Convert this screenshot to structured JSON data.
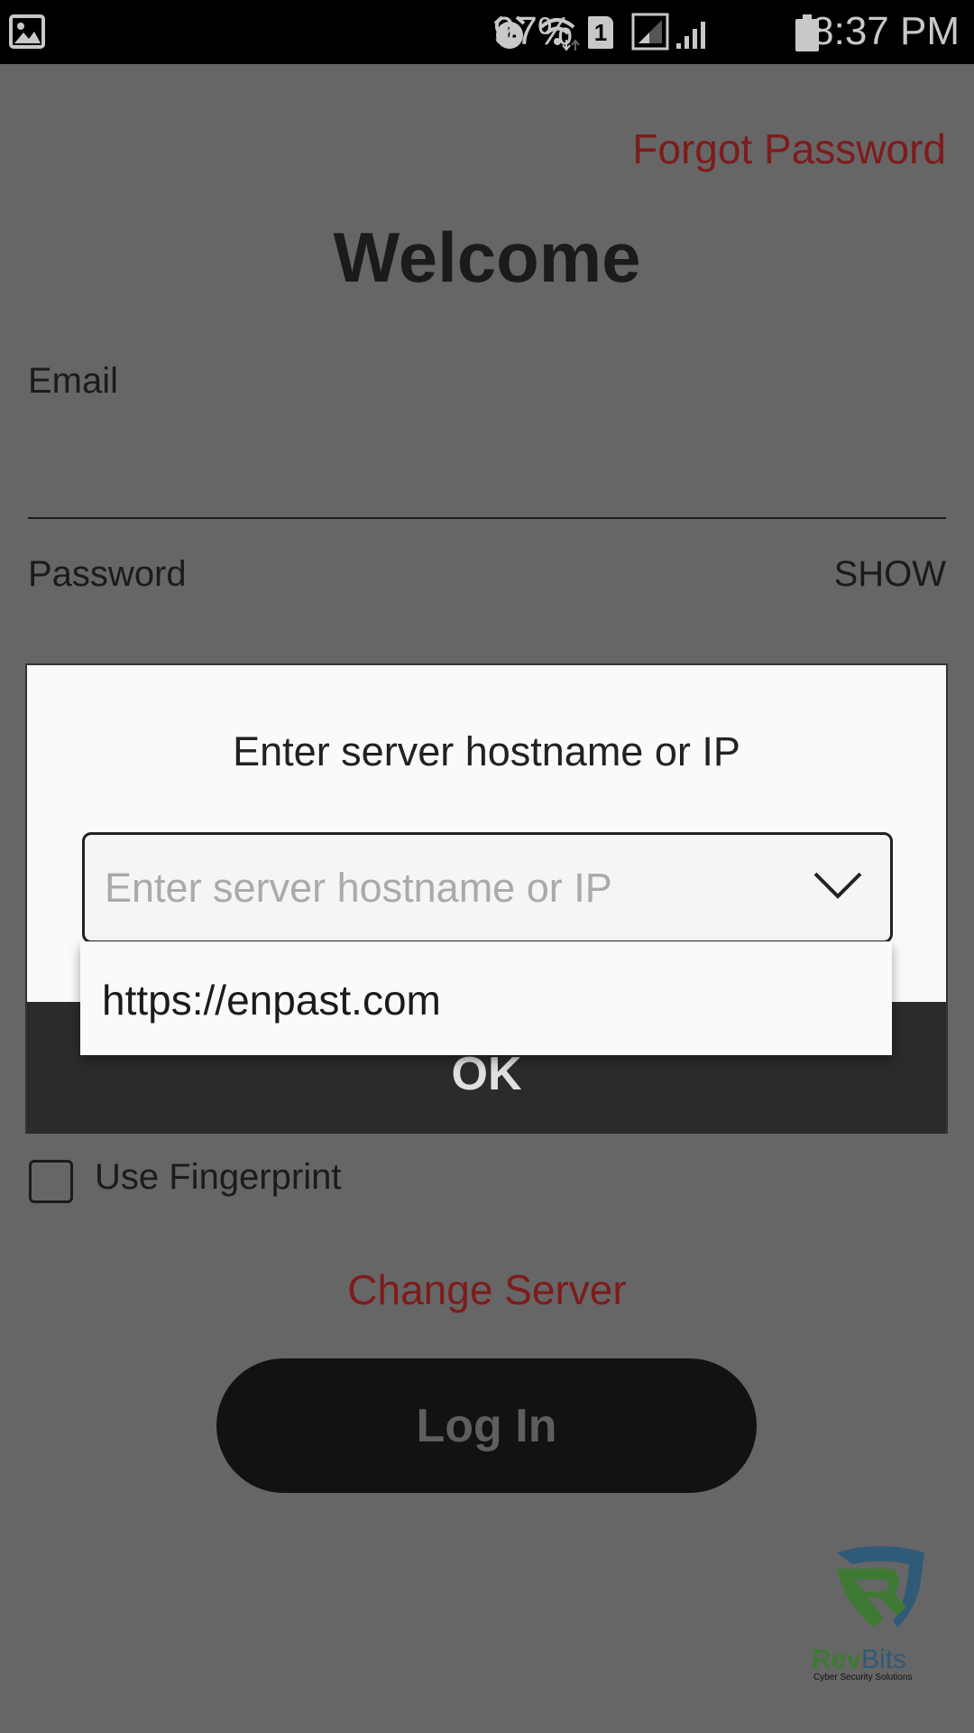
{
  "status_bar": {
    "battery": "97%",
    "time": "8:37 PM",
    "sim": "1",
    "icons": [
      "image-icon",
      "alarm-icon",
      "wifi-icon",
      "sim-icon",
      "signal-icon",
      "signal-icon",
      "battery-icon"
    ]
  },
  "login": {
    "forgot_password": "Forgot Password",
    "title": "Welcome",
    "email_label": "Email",
    "password_label": "Password",
    "show_label": "SHOW",
    "fingerprint_label": "Use Fingerprint",
    "fingerprint_checked": false,
    "change_server": "Change Server",
    "login_button": "Log In"
  },
  "dialog": {
    "title": "Enter server hostname or IP",
    "input_placeholder": "Enter server hostname or IP",
    "input_value": "",
    "suggestions": [
      "https://enpast.com"
    ],
    "ok_label": "OK"
  },
  "logo": {
    "name": "RevBits",
    "tagline": "Cyber Security Solutions"
  },
  "colors": {
    "accent_red": "#7e1b1b",
    "overlay": "#666666",
    "logo_green": "#3f7a35",
    "logo_blue": "#2f5a78"
  }
}
